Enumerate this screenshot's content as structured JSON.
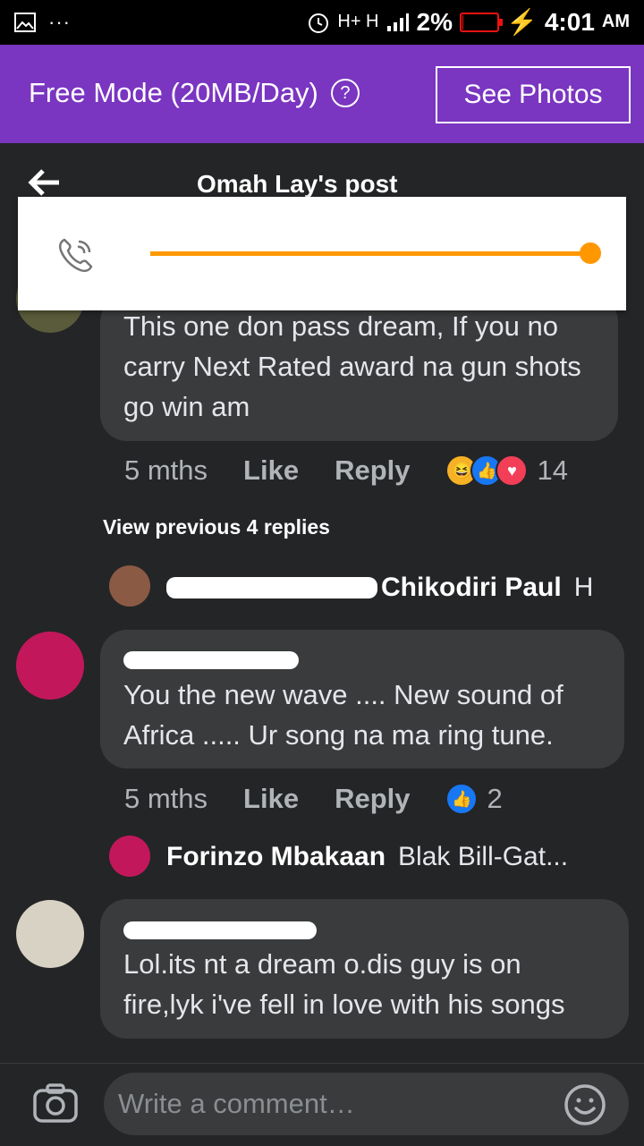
{
  "status_bar": {
    "battery": "2%",
    "battery_level": 0.02,
    "time": "4:01",
    "ampm": "AM",
    "network": "H+ H",
    "icons": [
      "gallery-icon",
      "more-icon",
      "alarm-icon",
      "signal-icon",
      "battery-icon",
      "charging-icon"
    ]
  },
  "free_mode": {
    "label": "Free Mode (20MB/Day)",
    "help_icon": "?",
    "see_photos": "See Photos"
  },
  "header": {
    "title": "Omah Lay's post"
  },
  "volume_overlay": {
    "level": 1.0,
    "accent": "#ff9800",
    "icon": "phone-ringing-icon"
  },
  "comments": [
    {
      "text": "This one don pass dream, If you no carry Next Rated award na gun shots go win am",
      "time": "5 mths",
      "like": "Like",
      "reply": "Reply",
      "reactions": [
        "haha",
        "like",
        "love"
      ],
      "reaction_count": "14"
    },
    {
      "text": "You the new wave .... New sound of Africa ..... Ur song na ma ring tune.",
      "time": "5 mths",
      "like": "Like",
      "reply": "Reply",
      "reactions": [
        "like"
      ],
      "reaction_count": "2"
    },
    {
      "text": "Lol.its nt a dream o.dis guy is on fire,lyk i've fell in love with his songs"
    }
  ],
  "view_previous": "View previous 4 replies",
  "replies": [
    {
      "name": "Chikodiri Paul",
      "snippet": "H"
    },
    {
      "name": "Forinzo Mbakaan",
      "snippet": "Blak Bill-Gat..."
    }
  ],
  "composer": {
    "placeholder": "Write a comment…"
  },
  "colors": {
    "purple": "#7a35c1",
    "bubble": "#3a3b3c",
    "background": "#242527",
    "like_blue": "#1877f2"
  }
}
